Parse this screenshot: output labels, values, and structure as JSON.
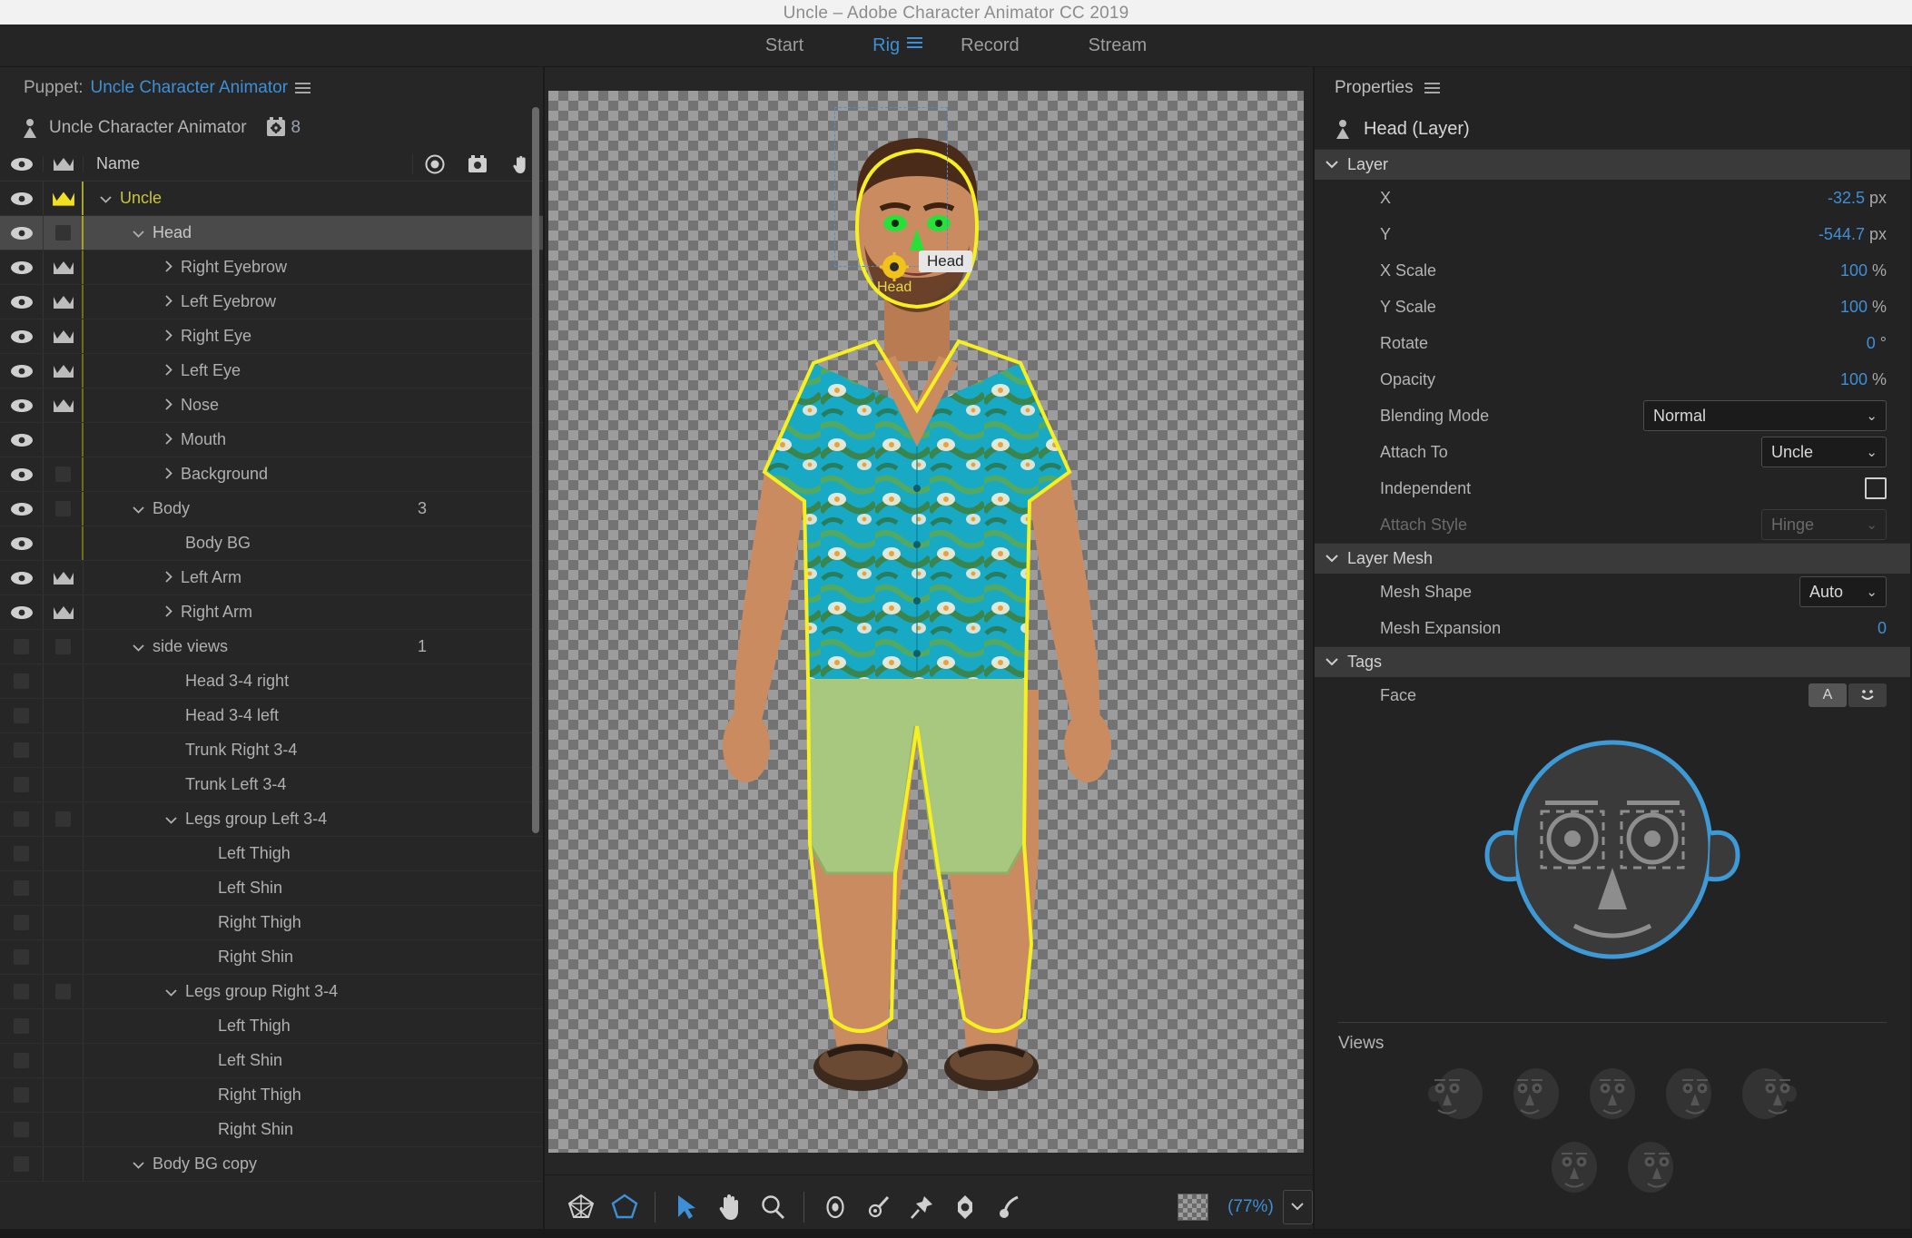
{
  "window": {
    "title": "Uncle – Adobe Character Animator CC 2019"
  },
  "workspace_tabs": [
    {
      "label": "Start",
      "active": false
    },
    {
      "label": "Rig",
      "active": true
    },
    {
      "label": "Record",
      "active": false
    },
    {
      "label": "Stream",
      "active": false
    }
  ],
  "puppet_panel": {
    "header_label": "Puppet:",
    "header_value": "Uncle Character Animator",
    "puppet_name": "Uncle Character Animator",
    "behavior_count": "8",
    "columns": {
      "name": "Name"
    },
    "rows": [
      {
        "name": "Uncle",
        "indent": 0,
        "eye": true,
        "crown": "gold",
        "twirl": "down",
        "chk": false,
        "num": "",
        "gold": true,
        "selected": false,
        "rail": "bright"
      },
      {
        "name": "Head",
        "indent": 1,
        "eye": true,
        "crown": "chk",
        "twirl": "down",
        "chk": true,
        "num": "",
        "gold": false,
        "selected": true,
        "rail": "bright"
      },
      {
        "name": "Right Eyebrow",
        "indent": 2,
        "eye": true,
        "crown": "white",
        "twirl": "right",
        "chk": false,
        "num": "",
        "gold": false,
        "selected": false,
        "rail": "dim"
      },
      {
        "name": "Left Eyebrow",
        "indent": 2,
        "eye": true,
        "crown": "white",
        "twirl": "right",
        "chk": false,
        "num": "",
        "gold": false,
        "selected": false,
        "rail": "dim"
      },
      {
        "name": "Right Eye",
        "indent": 2,
        "eye": true,
        "crown": "white",
        "twirl": "right",
        "chk": false,
        "num": "",
        "gold": false,
        "selected": false,
        "rail": "dim"
      },
      {
        "name": "Left Eye",
        "indent": 2,
        "eye": true,
        "crown": "white",
        "twirl": "right",
        "chk": false,
        "num": "",
        "gold": false,
        "selected": false,
        "rail": "dim"
      },
      {
        "name": "Nose",
        "indent": 2,
        "eye": true,
        "crown": "white",
        "twirl": "right",
        "chk": false,
        "num": "",
        "gold": false,
        "selected": false,
        "rail": "dim"
      },
      {
        "name": "Mouth",
        "indent": 2,
        "eye": true,
        "crown": "none",
        "twirl": "right",
        "chk": false,
        "num": "",
        "gold": false,
        "selected": false,
        "rail": "dim"
      },
      {
        "name": "Background",
        "indent": 2,
        "eye": true,
        "crown": "chk",
        "twirl": "right",
        "chk": true,
        "num": "",
        "gold": false,
        "selected": false,
        "rail": "dim"
      },
      {
        "name": "Body",
        "indent": 1,
        "eye": true,
        "crown": "chk",
        "twirl": "down",
        "chk": true,
        "num": "3",
        "gold": false,
        "selected": false,
        "rail": "dim"
      },
      {
        "name": "Body BG",
        "indent": 2,
        "eye": true,
        "crown": "none",
        "twirl": "none",
        "chk": false,
        "num": "",
        "gold": false,
        "selected": false,
        "rail": "dim"
      },
      {
        "name": "Left Arm",
        "indent": 2,
        "eye": true,
        "crown": "white",
        "twirl": "right",
        "chk": false,
        "num": "",
        "gold": false,
        "selected": false,
        "rail": "none"
      },
      {
        "name": "Right Arm",
        "indent": 2,
        "eye": true,
        "crown": "white",
        "twirl": "right",
        "chk": false,
        "num": "",
        "gold": false,
        "selected": false,
        "rail": "none"
      },
      {
        "name": "side views",
        "indent": 1,
        "eye": false,
        "crown": "chk",
        "twirl": "down",
        "chk": true,
        "num": "1",
        "gold": false,
        "selected": false,
        "rail": "none"
      },
      {
        "name": "Head 3-4 right",
        "indent": 2,
        "eye": false,
        "crown": "none",
        "twirl": "none",
        "chk": false,
        "num": "",
        "gold": false,
        "selected": false,
        "rail": "none"
      },
      {
        "name": "Head 3-4 left",
        "indent": 2,
        "eye": false,
        "crown": "none",
        "twirl": "none",
        "chk": false,
        "num": "",
        "gold": false,
        "selected": false,
        "rail": "none"
      },
      {
        "name": "Trunk Right 3-4",
        "indent": 2,
        "eye": false,
        "crown": "none",
        "twirl": "none",
        "chk": false,
        "num": "",
        "gold": false,
        "selected": false,
        "rail": "none"
      },
      {
        "name": "Trunk Left 3-4",
        "indent": 2,
        "eye": false,
        "crown": "none",
        "twirl": "none",
        "chk": false,
        "num": "",
        "gold": false,
        "selected": false,
        "rail": "none"
      },
      {
        "name": "Legs group Left 3-4",
        "indent": 2,
        "eye": false,
        "crown": "chk",
        "twirl": "down",
        "chk": true,
        "num": "",
        "gold": false,
        "selected": false,
        "rail": "none"
      },
      {
        "name": "Left Thigh",
        "indent": 3,
        "eye": false,
        "crown": "none",
        "twirl": "none",
        "chk": false,
        "num": "",
        "gold": false,
        "selected": false,
        "rail": "none"
      },
      {
        "name": "Left Shin",
        "indent": 3,
        "eye": false,
        "crown": "none",
        "twirl": "none",
        "chk": false,
        "num": "",
        "gold": false,
        "selected": false,
        "rail": "none"
      },
      {
        "name": "Right Thigh",
        "indent": 3,
        "eye": false,
        "crown": "none",
        "twirl": "none",
        "chk": false,
        "num": "",
        "gold": false,
        "selected": false,
        "rail": "none"
      },
      {
        "name": "Right Shin",
        "indent": 3,
        "eye": false,
        "crown": "none",
        "twirl": "none",
        "chk": false,
        "num": "",
        "gold": false,
        "selected": false,
        "rail": "none"
      },
      {
        "name": "Legs group Right 3-4",
        "indent": 2,
        "eye": false,
        "crown": "chk",
        "twirl": "down",
        "chk": true,
        "num": "",
        "gold": false,
        "selected": false,
        "rail": "none"
      },
      {
        "name": "Left Thigh",
        "indent": 3,
        "eye": false,
        "crown": "none",
        "twirl": "none",
        "chk": false,
        "num": "",
        "gold": false,
        "selected": false,
        "rail": "none"
      },
      {
        "name": "Left Shin",
        "indent": 3,
        "eye": false,
        "crown": "none",
        "twirl": "none",
        "chk": false,
        "num": "",
        "gold": false,
        "selected": false,
        "rail": "none"
      },
      {
        "name": "Right Thigh",
        "indent": 3,
        "eye": false,
        "crown": "none",
        "twirl": "none",
        "chk": false,
        "num": "",
        "gold": false,
        "selected": false,
        "rail": "none"
      },
      {
        "name": "Right Shin",
        "indent": 3,
        "eye": false,
        "crown": "none",
        "twirl": "none",
        "chk": false,
        "num": "",
        "gold": false,
        "selected": false,
        "rail": "none"
      },
      {
        "name": "Body BG copy",
        "indent": 1,
        "eye": false,
        "crown": "none",
        "twirl": "down",
        "chk": false,
        "num": "",
        "gold": false,
        "selected": false,
        "rail": "none"
      }
    ]
  },
  "canvas": {
    "head_tag_label": "Head",
    "head_origin_label": "Head",
    "zoom_label": "(77%)",
    "tools": [
      {
        "name": "mesh-tool",
        "title": "Show Mesh",
        "active": false
      },
      {
        "name": "polygon-tool",
        "title": "Crop Outline",
        "active": true
      },
      {
        "name": "select-tool",
        "title": "Select",
        "active": true
      },
      {
        "name": "hand-tool",
        "title": "Hand",
        "active": false
      },
      {
        "name": "zoom-tool",
        "title": "Zoom",
        "active": false
      },
      {
        "name": "origin-tool",
        "title": "Origin",
        "active": false
      },
      {
        "name": "handle-tool",
        "title": "Handle",
        "active": false
      },
      {
        "name": "stick-tool",
        "title": "Stick",
        "active": false
      },
      {
        "name": "dangle-tool",
        "title": "Dangle",
        "active": false
      },
      {
        "name": "stroke-tool",
        "title": "Pin / Stroke",
        "active": false
      }
    ]
  },
  "properties": {
    "panel_title": "Properties",
    "layer_title": "Head (Layer)",
    "sections": {
      "layer": {
        "title": "Layer",
        "rows": [
          {
            "key": "X",
            "value": "-32.5",
            "unit": " px",
            "type": "num"
          },
          {
            "key": "Y",
            "value": "-544.7",
            "unit": " px",
            "type": "num"
          },
          {
            "key": "X Scale",
            "value": "100",
            "unit": " %",
            "type": "num"
          },
          {
            "key": "Y Scale",
            "value": "100",
            "unit": " %",
            "type": "num"
          },
          {
            "key": "Rotate",
            "value": "0",
            "unit": " °",
            "type": "num"
          },
          {
            "key": "Opacity",
            "value": "100",
            "unit": " %",
            "type": "num"
          },
          {
            "key": "Blending Mode",
            "value": "Normal",
            "unit": "",
            "type": "select-wide"
          },
          {
            "key": "Attach To",
            "value": "Uncle",
            "unit": "",
            "type": "select-mid"
          },
          {
            "key": "Independent",
            "value": "",
            "unit": "",
            "type": "checkbox"
          },
          {
            "key": "Attach Style",
            "value": "Hinge",
            "unit": "",
            "type": "select-dis"
          }
        ]
      },
      "layer_mesh": {
        "title": "Layer Mesh",
        "rows": [
          {
            "key": "Mesh Shape",
            "value": "Auto",
            "unit": "",
            "type": "select-sm"
          },
          {
            "key": "Mesh Expansion",
            "value": "0",
            "unit": "",
            "type": "num"
          }
        ]
      },
      "tags": {
        "title": "Tags",
        "face_label": "Face",
        "tag_buttons": [
          {
            "label": "A",
            "name": "tag-letter-a",
            "selected": true
          },
          {
            "label": "☺",
            "name": "tag-face",
            "selected": false
          }
        ]
      }
    },
    "views": {
      "title": "Views",
      "row1_count": 5,
      "row2_count": 2
    }
  }
}
